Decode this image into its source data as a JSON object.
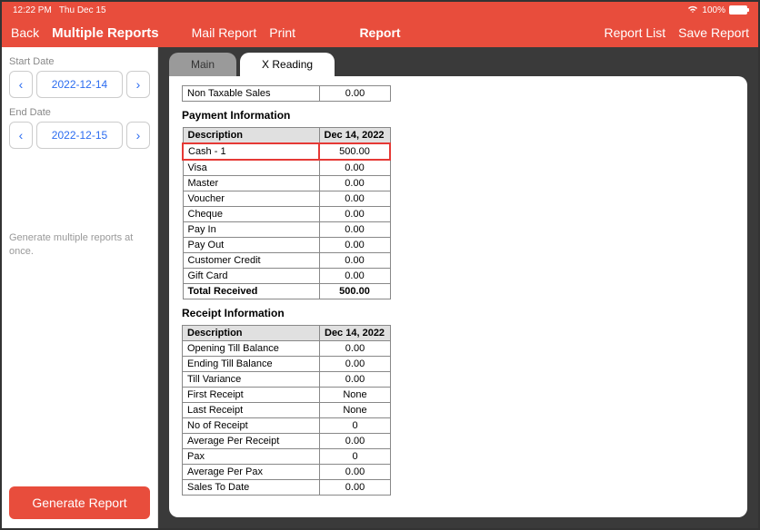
{
  "status": {
    "time": "12:22 PM",
    "date": "Thu Dec 15",
    "battery": "100%"
  },
  "header": {
    "back": "Back",
    "side_title": "Multiple Reports",
    "mail": "Mail Report",
    "print": "Print",
    "title": "Report",
    "report_list": "Report List",
    "save": "Save Report"
  },
  "sidebar": {
    "start_label": "Start Date",
    "start_date": "2022-12-14",
    "end_label": "End Date",
    "end_date": "2022-12-15",
    "helper": "Generate multiple reports at once.",
    "generate": "Generate Report"
  },
  "tabs": {
    "main": "Main",
    "xreading": "X Reading"
  },
  "top_row": {
    "label": "Non Taxable Sales",
    "value": "0.00"
  },
  "payment": {
    "title": "Payment Information",
    "col_desc": "Description",
    "col_date": "Dec 14, 2022",
    "rows": [
      {
        "label": "Cash - 1",
        "value": "500.00",
        "highlight": true
      },
      {
        "label": "Visa",
        "value": "0.00"
      },
      {
        "label": "Master",
        "value": "0.00"
      },
      {
        "label": "Voucher",
        "value": "0.00"
      },
      {
        "label": "Cheque",
        "value": "0.00"
      },
      {
        "label": "Pay In",
        "value": "0.00"
      },
      {
        "label": "Pay Out",
        "value": "0.00"
      },
      {
        "label": "Customer Credit",
        "value": "0.00"
      },
      {
        "label": "Gift Card",
        "value": "0.00"
      }
    ],
    "total_label": "Total Received",
    "total_value": "500.00"
  },
  "receipt": {
    "title": "Receipt Information",
    "col_desc": "Description",
    "col_date": "Dec 14, 2022",
    "rows": [
      {
        "label": "Opening Till Balance",
        "value": "0.00"
      },
      {
        "label": "Ending Till Balance",
        "value": "0.00"
      },
      {
        "label": "Till Variance",
        "value": "0.00"
      },
      {
        "label": "First Receipt",
        "value": "None"
      },
      {
        "label": "Last Receipt",
        "value": "None"
      },
      {
        "label": "No of Receipt",
        "value": "0"
      },
      {
        "label": "Average Per Receipt",
        "value": "0.00"
      },
      {
        "label": "Pax",
        "value": "0"
      },
      {
        "label": "Average Per Pax",
        "value": "0.00"
      },
      {
        "label": "Sales To Date",
        "value": "0.00"
      }
    ]
  }
}
